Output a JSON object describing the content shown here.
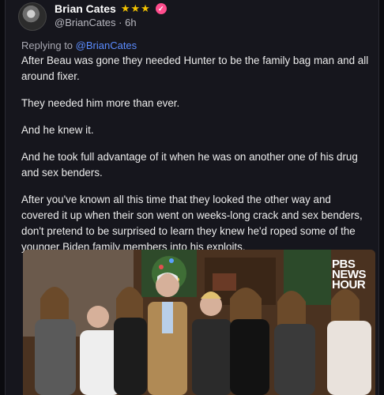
{
  "post": {
    "author_name": "Brian Cates",
    "author_stars": "★★★",
    "handle": "@BrianCates",
    "separator": "·",
    "time": "6h",
    "replying_prefix": "Replying to ",
    "replying_to": "@BrianCates",
    "paragraphs": [
      "After Beau was gone they needed Hunter to be the family bag man and all around fixer.",
      "They needed him more than ever.",
      "And he knew it.",
      "And he took full advantage of it when he was on another one of his drug and sex benders.",
      "After you've known all this time that they looked the other way and covered it up when their son went on weeks-long crack and sex benders, don't pretend to be surprised to learn they knew he'd roped some of the younger Biden family members into his exploits."
    ]
  },
  "image": {
    "watermark_line1": "PBS",
    "watermark_line2": "NEWS",
    "watermark_line3": "HOUR"
  },
  "colors": {
    "accent_link": "#5b8cff",
    "stars": "#f2c200",
    "badge": "#ff4d8d"
  }
}
